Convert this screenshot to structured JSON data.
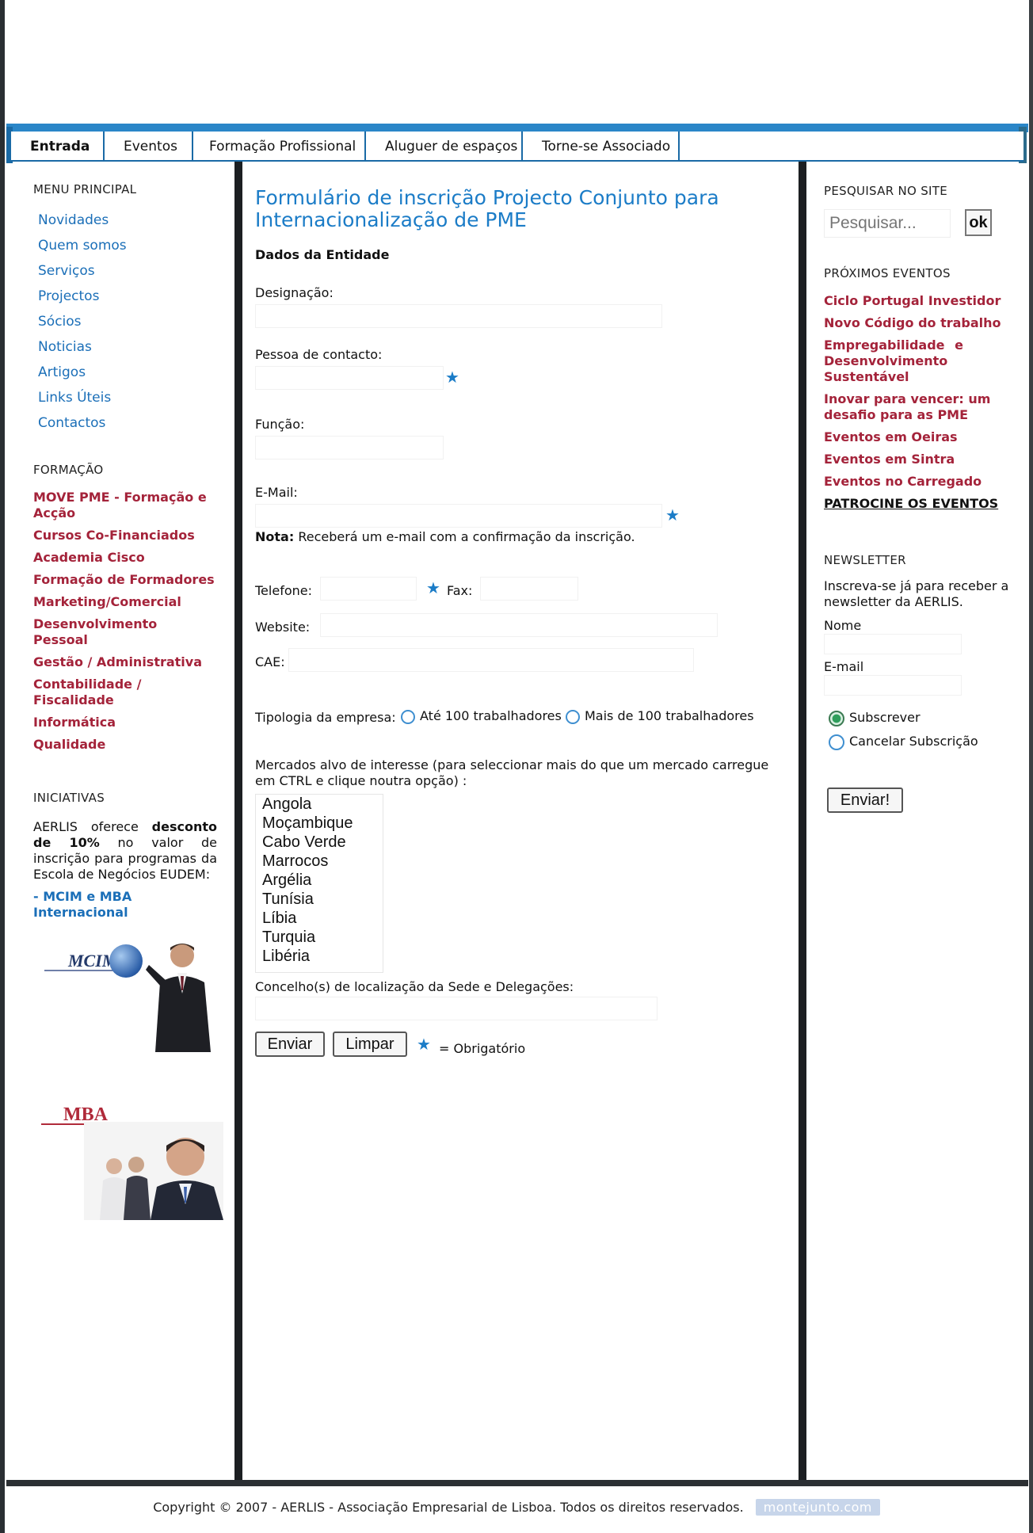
{
  "nav": {
    "items": [
      "Entrada",
      "Eventos",
      "Formação Profissional",
      "Aluguer de espaços",
      "Torne-se Associado"
    ],
    "active": "Entrada"
  },
  "left": {
    "menu_title": "MENU PRINCIPAL",
    "menu": [
      "Novidades",
      "Quem somos",
      "Serviços",
      "Projectos",
      "Sócios",
      "Noticias",
      "Artigos",
      "Links Úteis",
      "Contactos"
    ],
    "formacao_title": "FORMAÇÃO",
    "formacao": [
      "MOVE PME - Formação e Acção",
      "Cursos Co-Financiados",
      "Academia Cisco",
      "Formação de Formadores",
      "Marketing/Comercial",
      "Desenvolvimento Pessoal",
      "Gestão / Administrativa",
      "Contabilidade / Fiscalidade",
      "Informática",
      "Qualidade"
    ],
    "iniciativas_title": "INICIATIVAS",
    "iniciativas_text_1": "AERLIS oferece ",
    "iniciativas_bold": "desconto de 10%",
    "iniciativas_text_2": " no valor de inscrição para programas da Escola de Negócios EUDEM:",
    "iniciativas_link": "- MCIM e MBA Internacional",
    "ad1_logo": "MCIM",
    "ad2_logo": "MBA"
  },
  "form": {
    "title": "Formulário de inscrição Projecto Conjunto para Internacionalização de PME",
    "section": "Dados da Entidade",
    "designacao": "Designação:",
    "pessoa": "Pessoa de contacto:",
    "funcao": "Função:",
    "email": "E-Mail:",
    "nota_bold": "Nota:",
    "nota": " Receberá um e-mail com a confirmação da inscrição.",
    "telefone": "Telefone:",
    "fax": "Fax:",
    "website": "Website:",
    "cae": "CAE:",
    "tipologia": "Tipologia da empresa:",
    "tipologia_options": [
      "Até 100 trabalhadores",
      "Mais de 100 trabalhadores"
    ],
    "mercados": "Mercados alvo de interesse (para seleccionar mais do que um mercado carregue em CTRL e clique noutra opção) :",
    "mercados_options": [
      "Angola",
      "Moçambique",
      "Cabo Verde",
      "Marrocos",
      "Argélia",
      "Tunísia",
      "Líbia",
      "Turquia",
      "Libéria"
    ],
    "concelho": "Concelho(s) de localização da Sede e Delegações:",
    "enviar": "Enviar",
    "limpar": "Limpar",
    "obrigatorio": "= Obrigatório"
  },
  "right": {
    "pesquisar_title": "PESQUISAR NO SITE",
    "search_placeholder": "Pesquisar...",
    "search_button": "ok",
    "eventos_title": "PRÓXIMOS EVENTOS",
    "eventos": [
      "Ciclo Portugal Investidor",
      "Novo Código do trabalho",
      "Empregabilidade e Desenvolvimento Sustentável",
      "Inovar para vencer: um desafio para as PME",
      "Eventos em Oeiras",
      "Eventos em Sintra",
      "Eventos no Carregado"
    ],
    "patrocine": "PATROCINE OS EVENTOS",
    "newsletter_title": "NEWSLETTER",
    "newsletter_text": "Inscreva-se já para receber a newsletter da AERLIS.",
    "nome": "Nome",
    "email": "E-mail",
    "subscrever": "Subscrever",
    "cancelar": "Cancelar Subscrição",
    "enviar": "Enviar!"
  },
  "footer": {
    "text": "Copyright © 2007 - AERLIS - Associação Empresarial de Lisboa. Todos os direitos reservados.",
    "badge": "montejunto.com"
  },
  "colors": {
    "accent": "#1b7cc7",
    "red": "#a4233a",
    "dark": "#1c1f22"
  }
}
